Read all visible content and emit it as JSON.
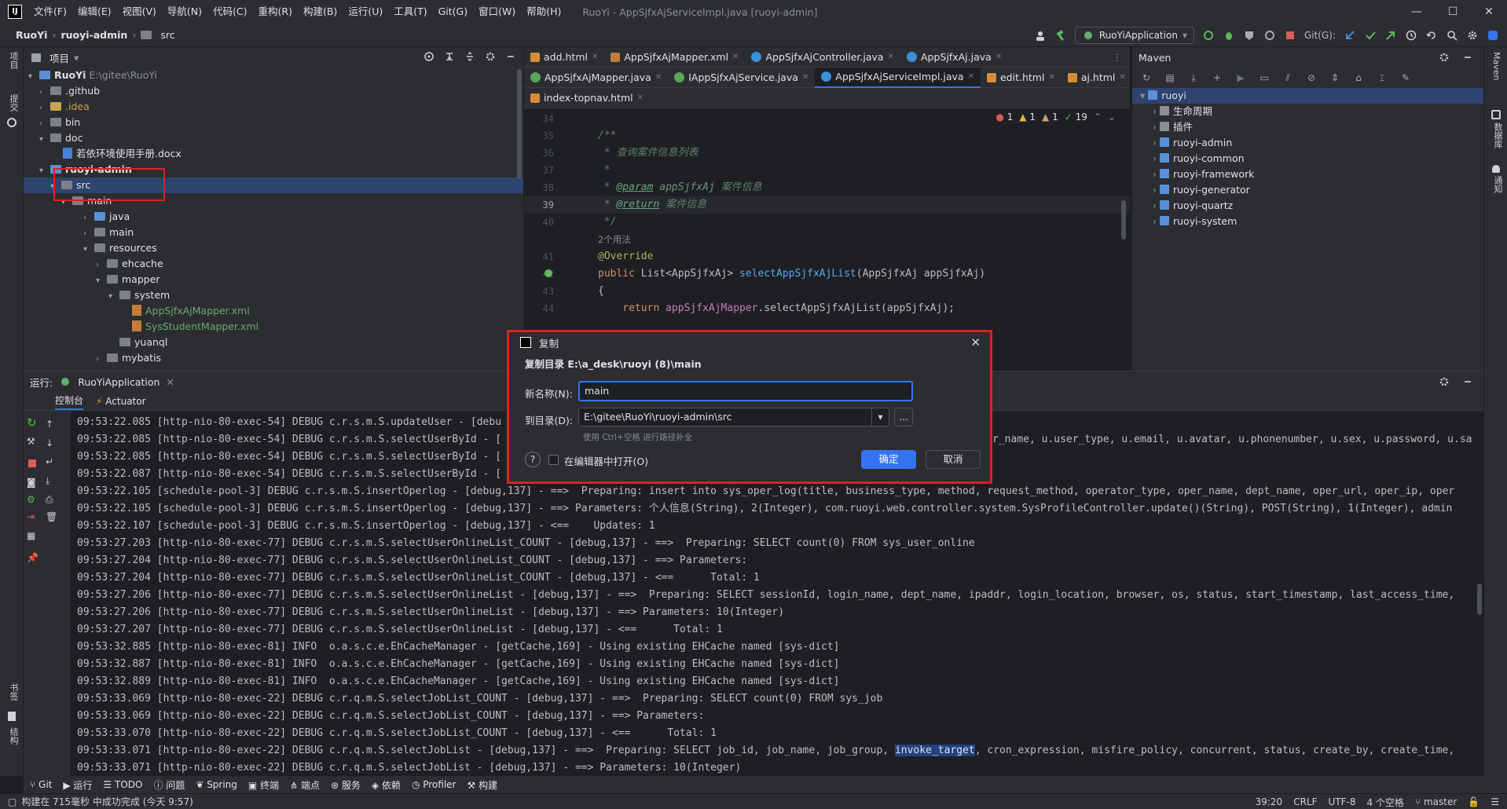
{
  "menu": [
    "文件(F)",
    "编辑(E)",
    "视图(V)",
    "导航(N)",
    "代码(C)",
    "重构(R)",
    "构建(B)",
    "运行(U)",
    "工具(T)",
    "Git(G)",
    "窗口(W)",
    "帮助(H)"
  ],
  "window_title": "RuoYi - AppSjfxAjServiceImpl.java [ruoyi-admin]",
  "breadcrumb": {
    "project": "RuoYi",
    "module": "ruoyi-admin",
    "folder": "src"
  },
  "run_config": "RuoYiApplication",
  "git_label": "Git(G):",
  "left_stripe": {
    "project": "项目",
    "commit": "提交",
    "bookmarks": "书签",
    "structure": "结构"
  },
  "right_stripe": {
    "maven": "Maven",
    "database": "数据库",
    "notifications": "通知"
  },
  "project_panel": {
    "title": "项目",
    "tree": [
      {
        "label": "RuoYi",
        "extra": "E:\\gitee\\RuoYi"
      },
      {
        "label": ".github"
      },
      {
        "label": ".idea"
      },
      {
        "label": "bin"
      },
      {
        "label": "doc"
      },
      {
        "label": "若依环境使用手册.docx"
      },
      {
        "label": "ruoyi-admin"
      },
      {
        "label": "src"
      },
      {
        "label": "main"
      },
      {
        "label": "java"
      },
      {
        "label": "main"
      },
      {
        "label": "resources"
      },
      {
        "label": "ehcache"
      },
      {
        "label": "mapper"
      },
      {
        "label": "system"
      },
      {
        "label": "AppSjfxAjMapper.xml"
      },
      {
        "label": "SysStudentMapper.xml"
      },
      {
        "label": "yuanql"
      },
      {
        "label": "mybatis"
      }
    ]
  },
  "editor": {
    "tabs_row1": [
      {
        "label": "add.html",
        "icon": "html"
      },
      {
        "label": "AppSjfxAjMapper.xml",
        "icon": "xml"
      },
      {
        "label": "AppSjfxAjController.java",
        "icon": "class"
      },
      {
        "label": "AppSjfxAj.java",
        "icon": "class"
      }
    ],
    "tabs_row2": [
      {
        "label": "AppSjfxAjMapper.java",
        "icon": "interface"
      },
      {
        "label": "IAppSjfxAjService.java",
        "icon": "interface"
      },
      {
        "label": "AppSjfxAjServiceImpl.java",
        "icon": "class",
        "active": true
      },
      {
        "label": "edit.html",
        "icon": "html"
      },
      {
        "label": "aj.html",
        "icon": "html"
      }
    ],
    "tabs_row3": [
      {
        "label": "index-topnav.html",
        "icon": "html"
      }
    ],
    "inspections": {
      "errors": "1",
      "warnings": "1",
      "weak": "1",
      "ok": "19"
    },
    "line_numbers": [
      "34",
      "35",
      "36",
      "37",
      "38",
      "39",
      "40",
      "",
      "41",
      "42",
      "43",
      "44"
    ],
    "code": {
      "l35": "/**",
      "l36": " * 查询案件信息列表",
      "l37": " *",
      "l38_tag": "@param",
      "l38_arg": "appSjfxAj",
      "l38_desc": "案件信息",
      "l39_tag": "@return",
      "l39_desc": "案件信息",
      "l40": " */",
      "usages": "2个用法",
      "l41": "@Override",
      "l42_kw": "public",
      "l42_type": "List<AppSjfxAj>",
      "l42_fn": "selectAppSjfxAjList",
      "l42_args": "(AppSjfxAj appSjfxAj)",
      "l43": "{",
      "l44_kw": "return",
      "l44_fld": "appSjfxAjMapper",
      "l44_rest": ".selectAppSjfxAjList(appSjfxAj);"
    }
  },
  "maven": {
    "title": "Maven",
    "items": [
      {
        "label": "ruoyi"
      },
      {
        "label": "生命周期"
      },
      {
        "label": "插件"
      },
      {
        "label": "ruoyi-admin"
      },
      {
        "label": "ruoyi-common"
      },
      {
        "label": "ruoyi-framework"
      },
      {
        "label": "ruoyi-generator"
      },
      {
        "label": "ruoyi-quartz"
      },
      {
        "label": "ruoyi-system"
      }
    ]
  },
  "run_panel": {
    "label": "运行:",
    "tab": "RuoYiApplication",
    "subtabs": [
      "控制台",
      "Actuator"
    ],
    "log": [
      "09:53:22.085 [http-nio-80-exec-54] DEBUG c.r.s.m.S.updateUser - [debu",
      "09:53:22.085 [http-nio-80-exec-54] DEBUG c.r.s.m.S.selectUserById - [",
      "09:53:22.085 [http-nio-80-exec-54] DEBUG c.r.s.m.S.selectUserById - [",
      "09:53:22.087 [http-nio-80-exec-54] DEBUG c.r.s.m.S.selectUserById - [",
      "09:53:22.105 [schedule-pool-3] DEBUG c.r.s.m.S.insertOperlog - [debug,137] - ==>  Preparing: insert into sys_oper_log(title, business_type, method, request_method, operator_type, oper_name, dept_name, oper_url, oper_ip, oper",
      "09:53:22.105 [schedule-pool-3] DEBUG c.r.s.m.S.insertOperlog - [debug,137] - ==> Parameters: 个人信息(String), 2(Integer), com.ruoyi.web.controller.system.SysProfileController.update()(String), POST(String), 1(Integer), admin",
      "09:53:22.107 [schedule-pool-3] DEBUG c.r.s.m.S.insertOperlog - [debug,137] - <==    Updates: 1",
      "09:53:27.203 [http-nio-80-exec-77] DEBUG c.r.s.m.S.selectUserOnlineList_COUNT - [debug,137] - ==>  Preparing: SELECT count(0) FROM sys_user_online",
      "09:53:27.204 [http-nio-80-exec-77] DEBUG c.r.s.m.S.selectUserOnlineList_COUNT - [debug,137] - ==> Parameters: ",
      "09:53:27.204 [http-nio-80-exec-77] DEBUG c.r.s.m.S.selectUserOnlineList_COUNT - [debug,137] - <==      Total: 1",
      "09:53:27.206 [http-nio-80-exec-77] DEBUG c.r.s.m.S.selectUserOnlineList - [debug,137] - ==>  Preparing: SELECT sessionId, login_name, dept_name, ipaddr, login_location, browser, os, status, start_timestamp, last_access_time,",
      "09:53:27.206 [http-nio-80-exec-77] DEBUG c.r.s.m.S.selectUserOnlineList - [debug,137] - ==> Parameters: 10(Integer)",
      "09:53:27.207 [http-nio-80-exec-77] DEBUG c.r.s.m.S.selectUserOnlineList - [debug,137] - <==      Total: 1",
      "09:53:32.885 [http-nio-80-exec-81] INFO  o.a.s.c.e.EhCacheManager - [getCache,169] - Using existing EHCache named [sys-dict]",
      "09:53:32.887 [http-nio-80-exec-81] INFO  o.a.s.c.e.EhCacheManager - [getCache,169] - Using existing EHCache named [sys-dict]",
      "09:53:32.889 [http-nio-80-exec-81] INFO  o.a.s.c.e.EhCacheManager - [getCache,169] - Using existing EHCache named [sys-dict]",
      "09:53:33.069 [http-nio-80-exec-22] DEBUG c.r.q.m.S.selectJobList_COUNT - [debug,137] - ==>  Preparing: SELECT count(0) FROM sys_job",
      "09:53:33.069 [http-nio-80-exec-22] DEBUG c.r.q.m.S.selectJobList_COUNT - [debug,137] - ==> Parameters: ",
      "09:53:33.070 [http-nio-80-exec-22] DEBUG c.r.q.m.S.selectJobList_COUNT - [debug,137] - <==      Total: 1"
    ],
    "log_last_prefix": "09:53:33.071 [http-nio-80-exec-22] DEBUG c.r.q.m.S.selectJobList - [debug,137] - ==>  Preparing: SELECT job_id, job_name, job_group, ",
    "log_last_highlight": "invoke_target",
    "log_last_suffix": ", cron_expression, misfire_policy, concurrent, status, create_by, create_time,",
    "log_cut": "09:53:33.071 [http-nio-80-exec-22] DEBUG c.r.q.m.S.selectJobList - [debug,137] - ==> Parameters: 10(Integer)",
    "log_tail_right": [
      "r_name, u.user_type, u.email, u.avatar, u.phonenumber, u.sex, u.password, u.sa"
    ]
  },
  "bottom_tools": [
    "Git",
    "运行",
    "TODO",
    "问题",
    "Spring",
    "终端",
    "端点",
    "服务",
    "依赖",
    "Profiler",
    "构建"
  ],
  "status": {
    "message": "构建在 715毫秒 中成功完成 (今天 9:57)",
    "position": "39:20",
    "line_sep": "CRLF",
    "encoding": "UTF-8",
    "indent": "4 个空格",
    "branch": "master"
  },
  "dialog": {
    "title": "复制",
    "heading": "复制目录 E:\\a_desk\\ruoyi (8)\\main",
    "name_label": "新名称(N):",
    "name_value": "main",
    "dir_label": "到目录(D):",
    "dir_value": "E:\\gitee\\RuoYi\\ruoyi-admin\\src",
    "hint": "使用 Ctrl+空格 进行路径补全",
    "open_in_editor": "在编辑器中打开(O)",
    "ok": "确定",
    "cancel": "取消",
    "browse": "..."
  }
}
